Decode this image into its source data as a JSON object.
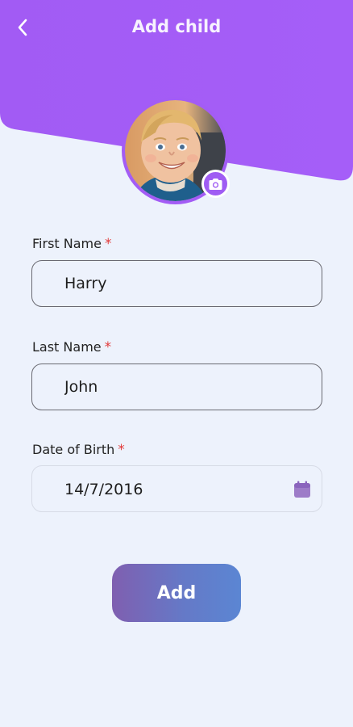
{
  "header": {
    "title": "Add child",
    "back_icon": "chevron-left-icon",
    "accent_color": "#a35cf5"
  },
  "avatar": {
    "alt": "Child photo",
    "camera_icon": "camera-icon"
  },
  "form": {
    "first_name": {
      "label": "First Name",
      "required_mark": "*",
      "value": "Harry"
    },
    "last_name": {
      "label": "Last Name",
      "required_mark": "*",
      "value": "John"
    },
    "date_of_birth": {
      "label": "Date of Birth",
      "required_mark": "*",
      "value": "14/7/2016",
      "icon": "calendar-icon"
    }
  },
  "actions": {
    "add_label": "Add"
  }
}
